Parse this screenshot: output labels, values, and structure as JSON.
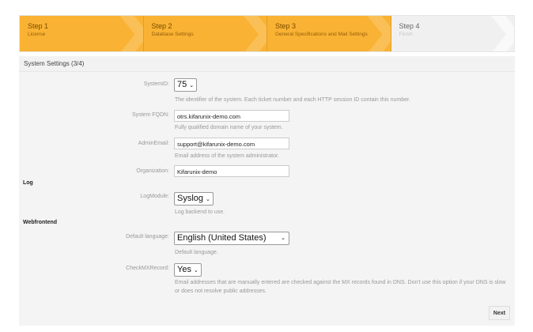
{
  "steps": [
    {
      "title": "Step 1",
      "subtitle": "License",
      "state": "done"
    },
    {
      "title": "Step 2",
      "subtitle": "Database Settings",
      "state": "done"
    },
    {
      "title": "Step 3",
      "subtitle": "General Specifications and Mail Settings",
      "state": "done"
    },
    {
      "title": "Step 4",
      "subtitle": "Finish",
      "state": "todo"
    }
  ],
  "panel": {
    "title": "System Settings (3/4)"
  },
  "fields": {
    "systemid": {
      "label": "SystemID:",
      "value": "75",
      "help": "The identifier of the system. Each ticket number and each HTTP session ID contain this number."
    },
    "fqdn": {
      "label": "System FQDN:",
      "value": "otrs.kifarunix-demo.com",
      "help": "Fully qualified domain name of your system."
    },
    "adminemail": {
      "label": "AdminEmail:",
      "value": "support@kifarunix-demo.com",
      "help": "Email address of the system administrator."
    },
    "organization": {
      "label": "Organization:",
      "value": "Kifarunix-demo"
    },
    "logmodule": {
      "label": "LogModule:",
      "value": "Syslog",
      "help": "Log backend to use."
    },
    "language": {
      "label": "Default language:",
      "value": "English (United States)",
      "help": "Default language."
    },
    "checkmx": {
      "label": "CheckMXRecord:",
      "value": "Yes",
      "help": "Email addresses that are manually entered are checked against the MX records found in DNS. Don't use this option if your DNS is slow or does not resolve public addresses."
    }
  },
  "sections": {
    "log": "Log",
    "webfrontend": "Webfrontend"
  },
  "next_label": "Next",
  "colors": {
    "step_done": "#f9b233",
    "step_todo": "#f0f0f0"
  }
}
